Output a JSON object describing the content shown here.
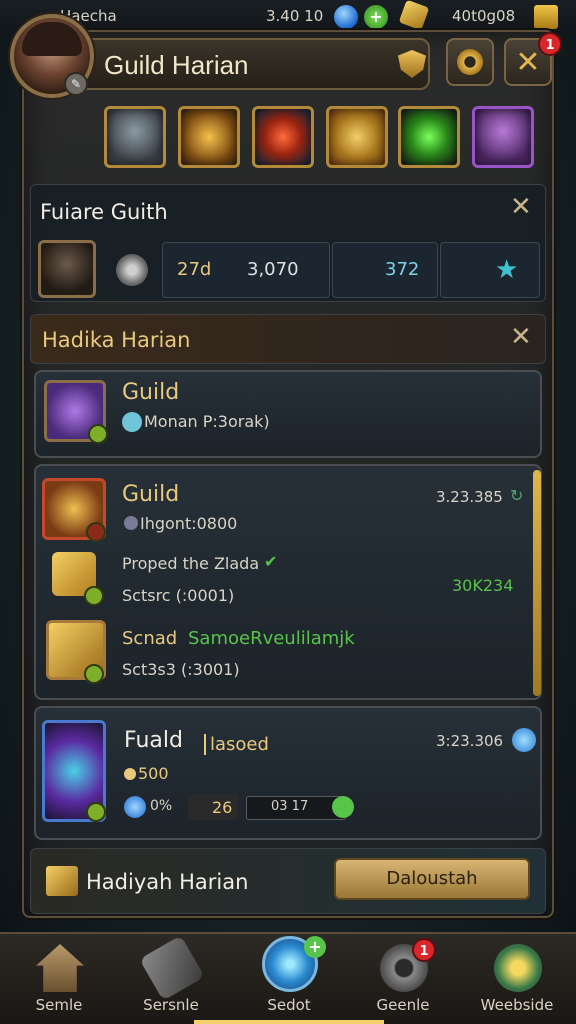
{
  "status_bar": {
    "left_text": "Haecha",
    "currency_1": "3.40 10",
    "currency_2": "40t0g08"
  },
  "header": {
    "title": "Guild Harian",
    "close_badge": "1"
  },
  "items_row": {
    "icons": [
      "hero-portrait-icon",
      "gold-shard-icon",
      "red-crystal-icon",
      "gold-scroll-icon",
      "green-crystal-icon",
      "purple-hero-icon"
    ]
  },
  "guild_section": {
    "title": "Fuiare Guith",
    "stat_1": "27d",
    "stat_2": "3,070",
    "stat_3": "372"
  },
  "daily_section": {
    "title": "Hadika Harian"
  },
  "quests": [
    {
      "title": "Guild",
      "subtitle": "Monan P:3orak)"
    },
    {
      "title": "Guild",
      "value": "3.23.385",
      "line_1": "Ihgont:0800",
      "line_2": "Proped the Zlada",
      "line_3": "Sctsrc  (:0001)",
      "green_value": "30K234",
      "line_4_left": "Scnad",
      "line_4_right": "SamoeRveulilamjk",
      "line_5": "Sct3s3  (:3001)"
    },
    {
      "title": "Fuald",
      "tag": "lasoed",
      "value": "3:23.306",
      "reward": "500",
      "stat_a": "0%",
      "stat_b": "26",
      "stat_c": "03  17"
    }
  ],
  "footer": {
    "label": "Hadiyah Harian",
    "button": "Daloustah"
  },
  "nav": [
    {
      "label": "Semle"
    },
    {
      "label": "Sersnle"
    },
    {
      "label": "Sedot"
    },
    {
      "label": "Geenle",
      "badge": "1"
    },
    {
      "label": "Weebside"
    }
  ],
  "colors": {
    "accent_gold": "#e9c97e",
    "green_text": "#58c44a",
    "cyan_text": "#7fd3e8"
  }
}
